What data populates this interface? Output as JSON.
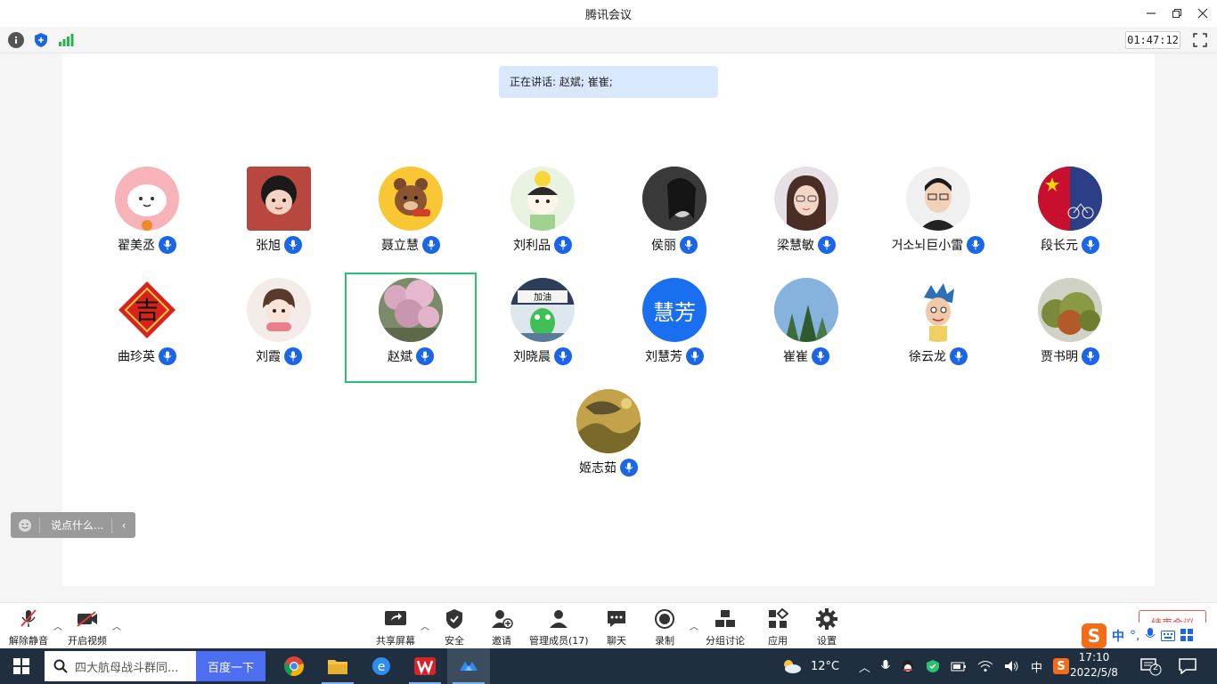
{
  "window": {
    "title": "腾讯会议"
  },
  "infobar": {
    "timer": "01:47:12"
  },
  "speaking": {
    "text": "正在讲话: 赵斌; 崔崔;"
  },
  "participants": [
    {
      "name": "翟美丞"
    },
    {
      "name": "张旭"
    },
    {
      "name": "聂立慧"
    },
    {
      "name": "刘利品"
    },
    {
      "name": "侯丽"
    },
    {
      "name": "梁慧敏"
    },
    {
      "name": "거소뇌巨小雷"
    },
    {
      "name": "段长元"
    },
    {
      "name": "曲珍英"
    },
    {
      "name": "刘霞"
    },
    {
      "name": "赵斌"
    },
    {
      "name": "刘晓晨"
    },
    {
      "name": "刘慧芳",
      "avatar_text": "慧芳"
    },
    {
      "name": "崔崔"
    },
    {
      "name": "徐云龙"
    },
    {
      "name": "贾书明"
    },
    {
      "name": "姬志茹"
    }
  ],
  "chat": {
    "placeholder": "说点什么..."
  },
  "toolbar": {
    "unmute": "解除静音",
    "start_video": "开启视频",
    "share_screen": "共享屏幕",
    "security": "安全",
    "invite": "邀请",
    "manage_members": "管理成员(17)",
    "chat": "聊天",
    "record": "录制",
    "breakout": "分组讨论",
    "apps": "应用",
    "settings": "设置",
    "end_meeting": "结束会议"
  },
  "ime": {
    "mode": "中"
  },
  "taskbar": {
    "search_text": "四大航母战斗群同...",
    "baidu_button": "百度一下",
    "weather": "12°C",
    "ime_lang": "中",
    "time": "17:10",
    "date": "2022/5/8",
    "notifications": "2"
  },
  "colors": {
    "accent": "#1a66e6",
    "speaking_bg": "#d9e8fd",
    "active_border": "#2fbf71",
    "taskbar": "#1f2f3f"
  }
}
